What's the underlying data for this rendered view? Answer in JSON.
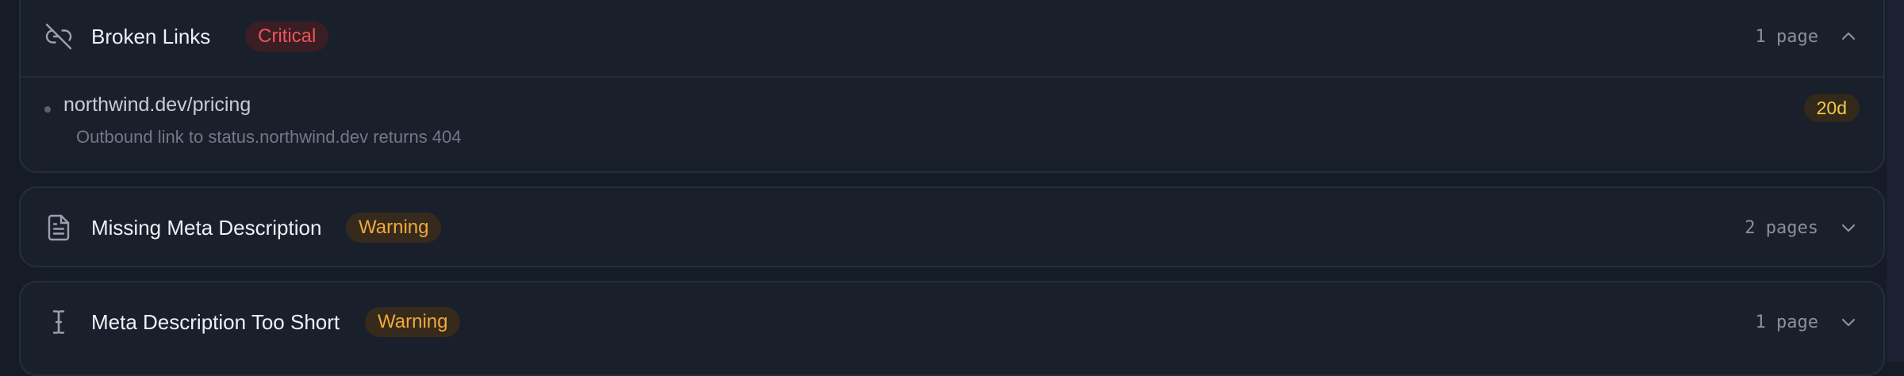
{
  "issues": [
    {
      "title": "Broken Links",
      "icon": "unlink-icon",
      "severity": "Critical",
      "count": "1 page",
      "expanded": true,
      "pages": [
        {
          "url": "northwind.dev/pricing",
          "detail": "Outbound link to status.northwind.dev returns 404",
          "age": "20d"
        }
      ]
    },
    {
      "title": "Missing Meta Description",
      "icon": "document-icon",
      "severity": "Warning",
      "count": "2 pages",
      "expanded": false
    },
    {
      "title": "Meta Description Too Short",
      "icon": "text-cursor-icon",
      "severity": "Warning",
      "count": "1 page",
      "expanded": false
    }
  ],
  "colors": {
    "critical": "#f0535c",
    "warning": "#f2a93b",
    "age_badge": "#f2c94c",
    "background": "#161b28",
    "card": "#1a1f2c"
  }
}
